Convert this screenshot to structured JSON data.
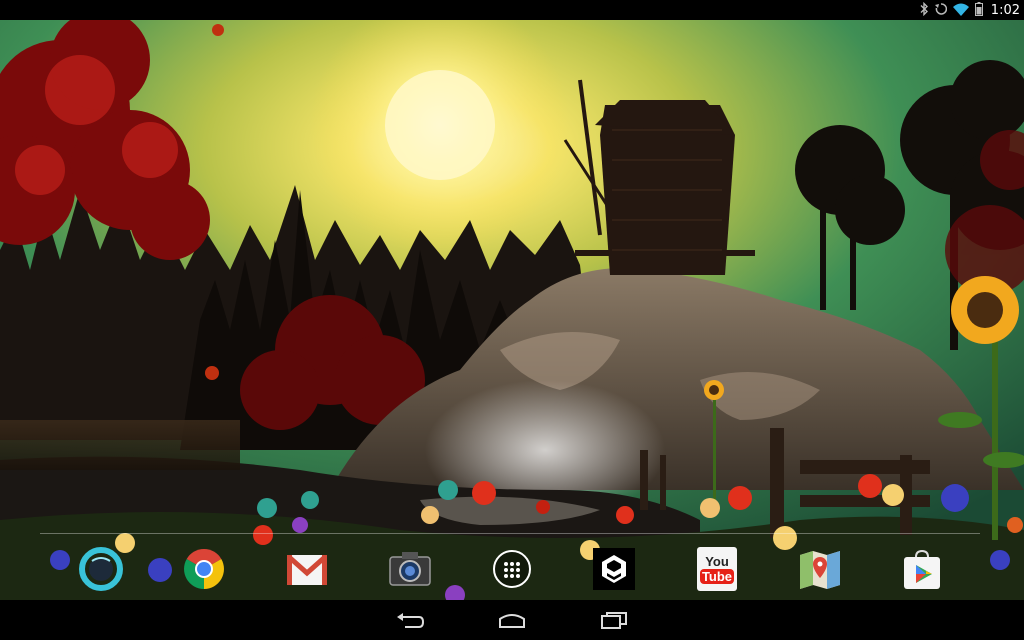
{
  "status_bar": {
    "time": "1:02",
    "icons": [
      "bluetooth-icon",
      "sync-icon",
      "wifi-icon",
      "battery-icon"
    ]
  },
  "wallpaper": {
    "description_icon": "windmill-live-wallpaper"
  },
  "dock": {
    "apps": [
      {
        "name": "moto-circle",
        "icon": "circle-app-icon"
      },
      {
        "name": "chrome",
        "icon": "chrome-icon"
      },
      {
        "name": "gmail",
        "icon": "gmail-icon"
      },
      {
        "name": "camera",
        "icon": "camera-icon"
      },
      {
        "name": "app-drawer",
        "icon": "apps-grid-icon"
      },
      {
        "name": "9gag",
        "icon": "9gag-icon"
      },
      {
        "name": "youtube",
        "icon": "youtube-icon",
        "label_line1": "You",
        "label_line2": "Tube"
      },
      {
        "name": "maps",
        "icon": "maps-icon"
      },
      {
        "name": "play-store",
        "icon": "play-store-icon"
      }
    ]
  },
  "nav_bar": {
    "buttons": [
      "back-icon",
      "home-icon",
      "recents-icon"
    ]
  },
  "colors": {
    "sky_green": "#2f7a4a",
    "sun": "#fff6a0",
    "youtube_red": "#e62117",
    "gmail_red": "#d14836"
  }
}
